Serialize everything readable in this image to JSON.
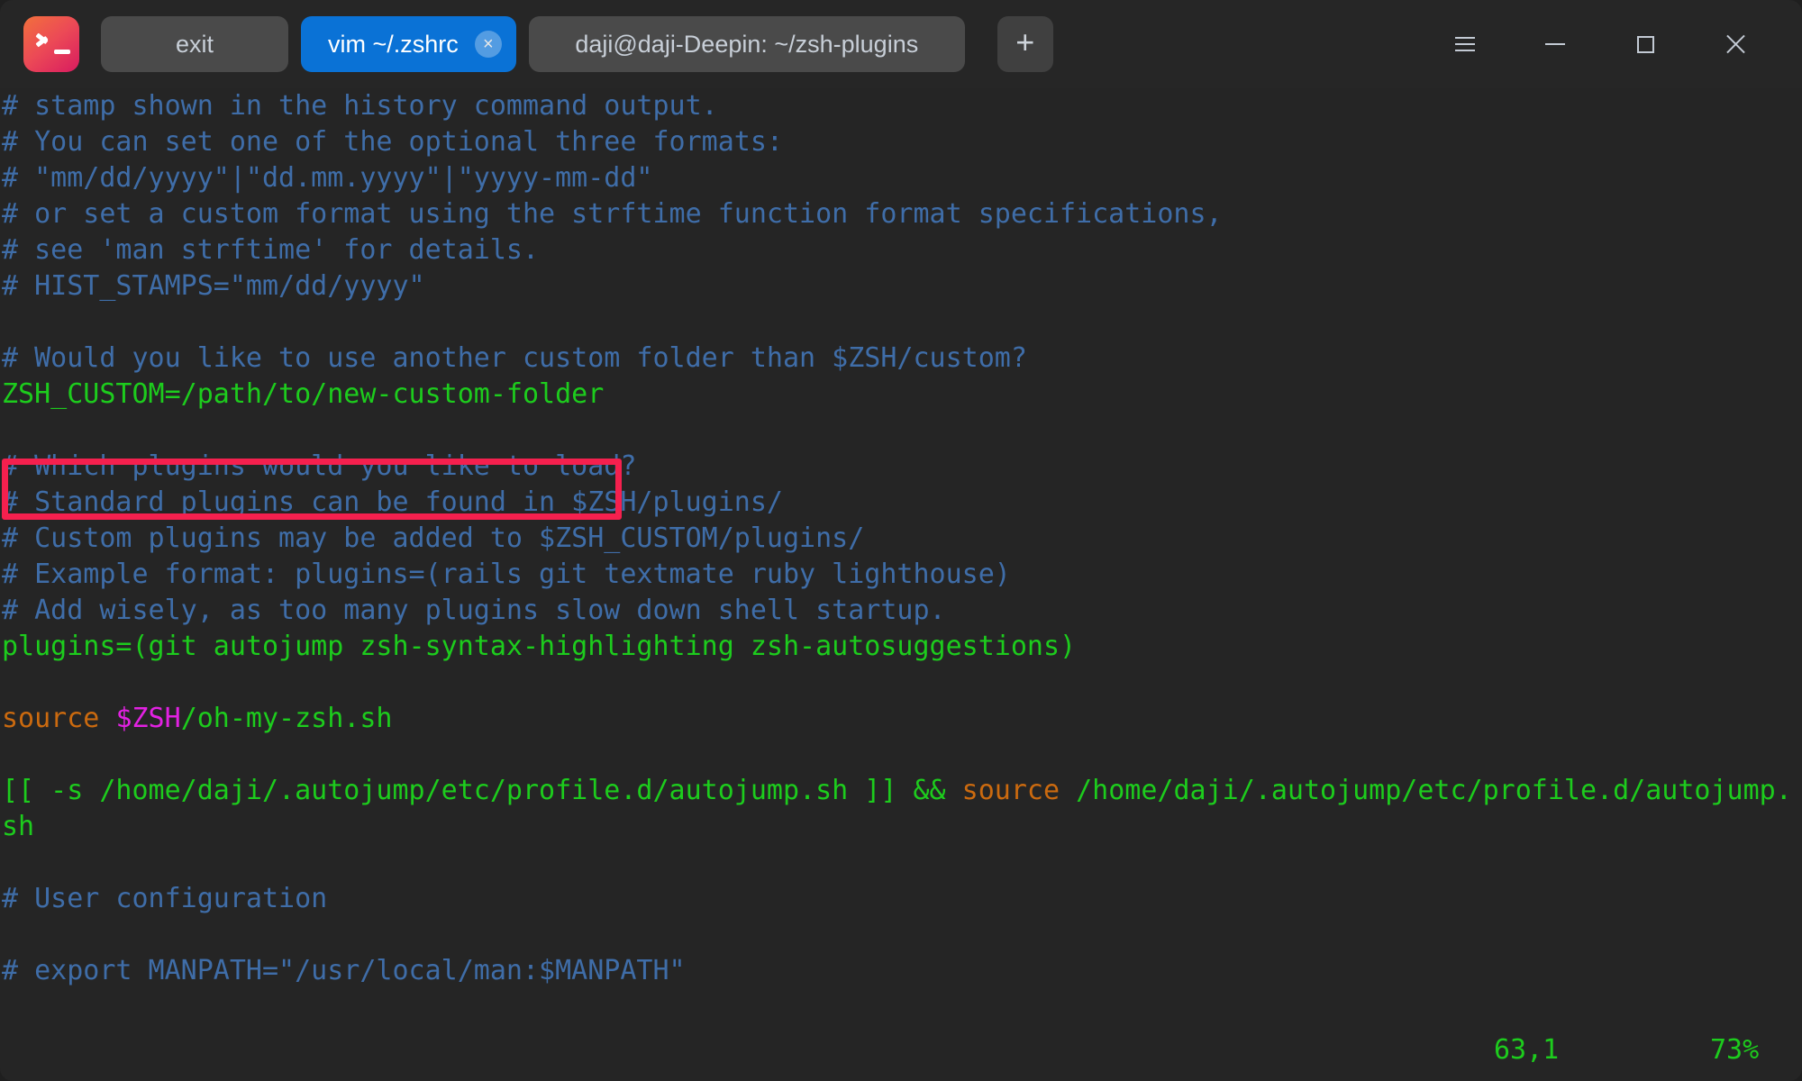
{
  "window": {
    "app_icon": "terminal-prompt-icon",
    "accent_active_tab": "#0a72d6",
    "titlebar_bg": "#262626",
    "terminal_bg": "#252525",
    "controls": {
      "menu_label": "menu-icon",
      "minimize_label": "minimize-icon",
      "maximize_label": "maximize-icon",
      "close_label": "close-icon"
    },
    "new_tab_label": "+"
  },
  "tabs": [
    {
      "label": "exit",
      "active": false,
      "closable": false
    },
    {
      "label": "vim ~/.zshrc",
      "active": true,
      "closable": true,
      "close_label": "×"
    },
    {
      "label": "daji@daji-Deepin: ~/zsh-plugins",
      "active": false,
      "closable": false
    }
  ],
  "terminal": {
    "lines": [
      {
        "text": "# stamp shown in the history command output.",
        "color": "comment"
      },
      {
        "text": "# You can set one of the optional three formats:",
        "color": "comment"
      },
      {
        "text": "# \"mm/dd/yyyy\"|\"dd.mm.yyyy\"|\"yyyy-mm-dd\"",
        "color": "comment"
      },
      {
        "text": "# or set a custom format using the strftime function format specifications,",
        "color": "comment"
      },
      {
        "text": "# see 'man strftime' for details.",
        "color": "comment"
      },
      {
        "text": "# HIST_STAMPS=\"mm/dd/yyyy\"",
        "color": "comment"
      },
      {
        "text": "",
        "color": "comment"
      },
      {
        "text": "# Would you like to use another custom folder than $ZSH/custom?",
        "color": "comment"
      },
      {
        "text": "ZSH_CUSTOM=/path/to/new-custom-folder",
        "color": "green"
      },
      {
        "text": "",
        "color": "comment"
      },
      {
        "text": "# Which plugins would you like to load?",
        "color": "comment"
      },
      {
        "text": "# Standard plugins can be found in $ZSH/plugins/",
        "color": "comment"
      },
      {
        "text": "# Custom plugins may be added to $ZSH_CUSTOM/plugins/",
        "color": "comment"
      },
      {
        "text": "# Example format: plugins=(rails git textmate ruby lighthouse)",
        "color": "comment"
      },
      {
        "text": "# Add wisely, as too many plugins slow down shell startup.",
        "color": "comment"
      },
      {
        "text": "plugins=(git autojump zsh-syntax-highlighting zsh-autosuggestions)",
        "color": "green"
      },
      {
        "text": "",
        "color": "comment"
      },
      {
        "text": "source $ZSH/oh-my-zsh.sh",
        "color": "mixed-source-zsh"
      },
      {
        "text": "",
        "color": "comment"
      },
      {
        "text": "[[ -s /home/daji/.autojump/etc/profile.d/autojump.sh ]] && source /home/daji/.autojump/etc/profile.d/autojump.",
        "color": "mixed-autojump"
      },
      {
        "text": "sh",
        "color": "green"
      },
      {
        "text": "",
        "color": "comment"
      },
      {
        "text": "# User configuration",
        "color": "comment"
      },
      {
        "text": "",
        "color": "comment"
      },
      {
        "text": "# export MANPATH=\"/usr/local/man:$MANPATH\"",
        "color": "comment"
      }
    ],
    "segments": {
      "source_zsh": [
        {
          "t": "source",
          "c": "orange"
        },
        {
          "t": " ",
          "c": "green"
        },
        {
          "t": "$ZSH",
          "c": "magenta"
        },
        {
          "t": "/oh-my-zsh.sh",
          "c": "green"
        }
      ],
      "autojump": [
        {
          "t": "[[ -s /home/daji/.autojump/etc/profile.d/autojump.sh ]] && ",
          "c": "green"
        },
        {
          "t": "source",
          "c": "orange"
        },
        {
          "t": " /home/daji/.autojump/etc/profile.d/autojump.",
          "c": "green"
        }
      ]
    },
    "colors": {
      "comment": "#3f6da8",
      "green": "#1dcc1d",
      "orange": "#cb6a0f",
      "magenta": "#e221e2"
    }
  },
  "annotation": {
    "kind": "red-rectangle-highlight",
    "color": "#f5204e",
    "targets_line": "ZSH_CUSTOM=/path/to/new-custom-folder"
  },
  "status_line": {
    "cursor_position": "63,1",
    "scroll_percent": "73%"
  }
}
